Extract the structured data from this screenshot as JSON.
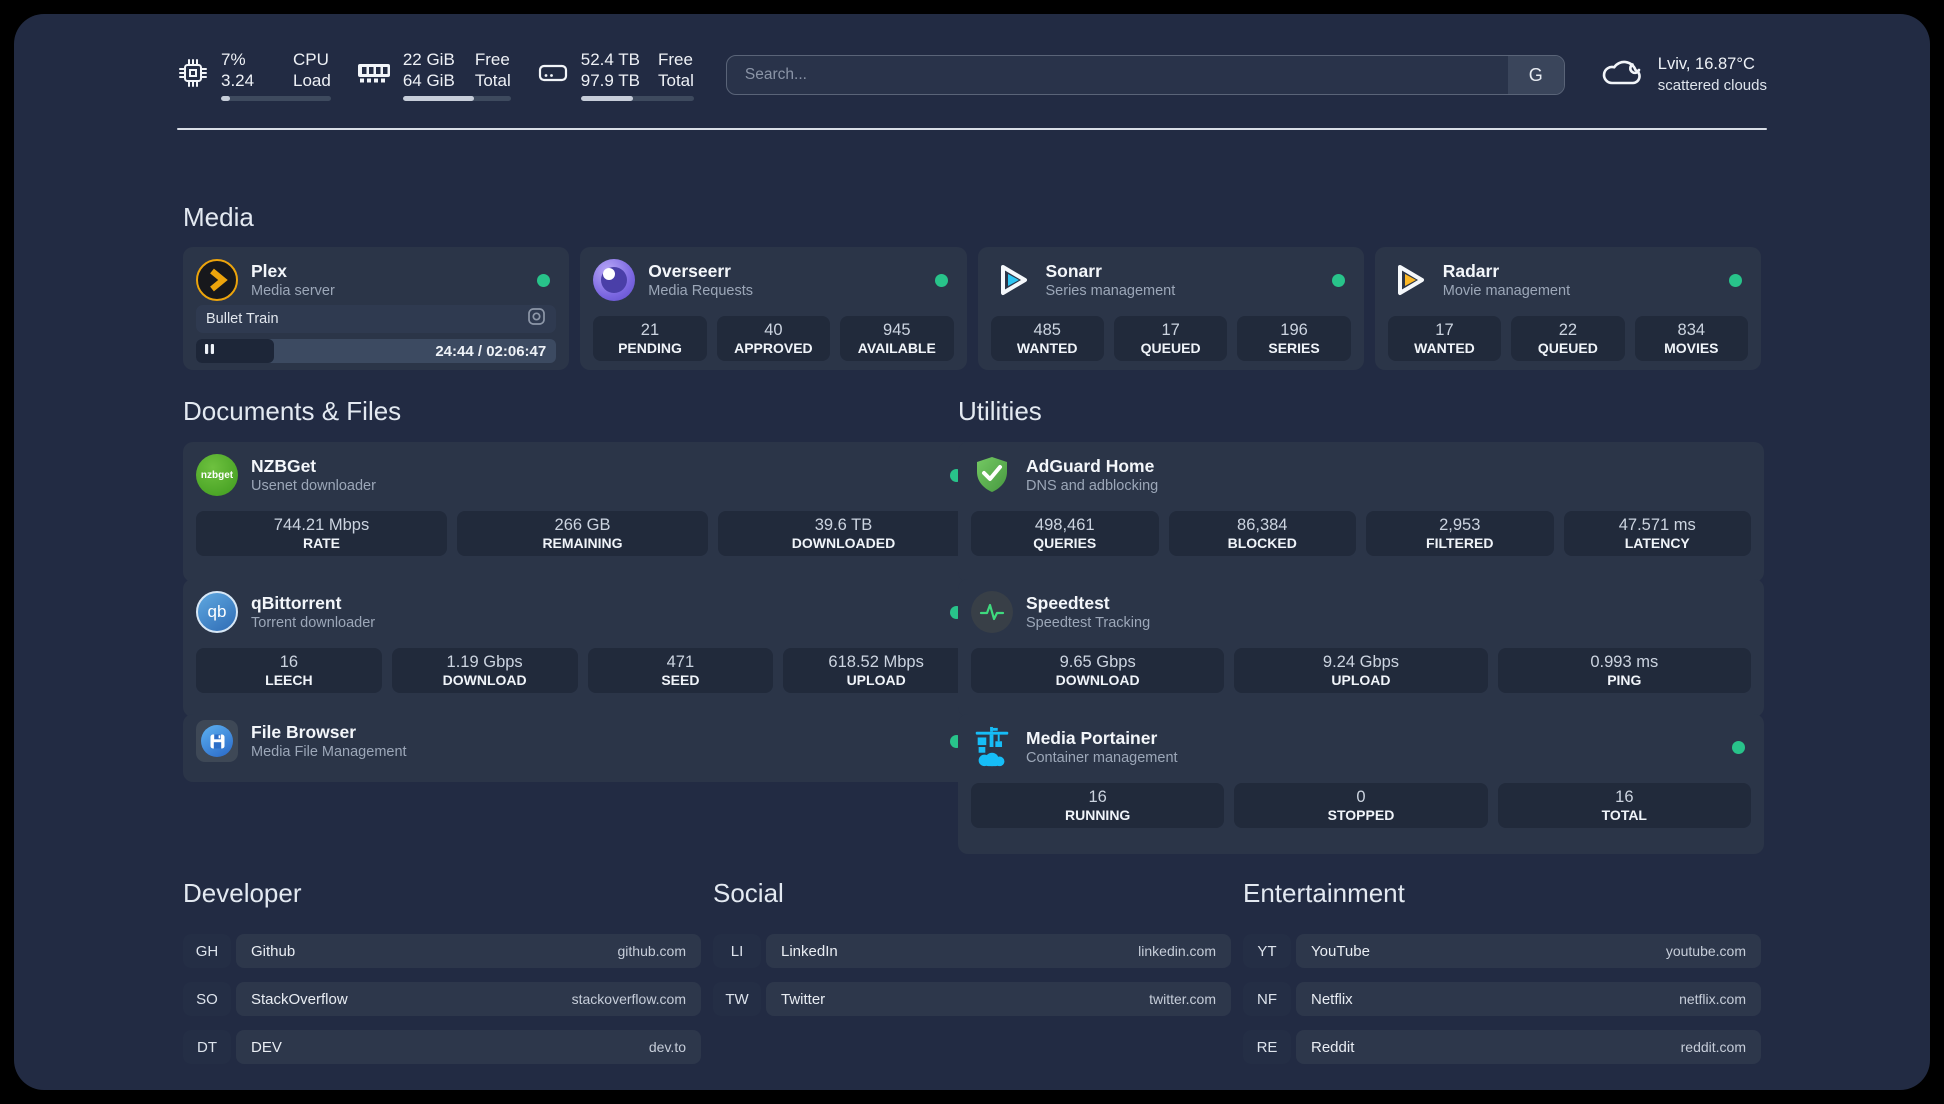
{
  "colors": {
    "status_online": "#28c38a",
    "panel_bg": "#222b43",
    "card_bg": "#2b3548",
    "plex_amber": "#eca40c",
    "sonarr_cyan": "#2ec5f1",
    "radarr_amber": "#fcb826",
    "adguard_green": "#5aaf4b",
    "portainer_blue": "#16bdf7",
    "speedtest_green": "#3eda7e"
  },
  "header": {
    "stats": [
      {
        "icon": "cpu-icon",
        "value_top": "7%",
        "value_bottom": "3.24",
        "label_top": "CPU",
        "label_bottom": "Load",
        "progress_pct": 8
      },
      {
        "icon": "memory-icon",
        "value_top": "22 GiB",
        "value_bottom": "64 GiB",
        "label_top": "Free",
        "label_bottom": "Total",
        "progress_pct": 66
      },
      {
        "icon": "disk-icon",
        "value_top": "52.4 TB",
        "value_bottom": "97.9 TB",
        "label_top": "Free",
        "label_bottom": "Total",
        "progress_pct": 46
      }
    ],
    "search": {
      "placeholder": "Search...",
      "button": "G"
    },
    "weather": {
      "icon": "cloud-icon",
      "line1": "Lviv, 16.87°C",
      "line2": "scattered clouds"
    }
  },
  "sections": {
    "media": {
      "title": "Media",
      "apps": [
        {
          "name": "Plex",
          "description": "Media server",
          "online": true,
          "now_playing": {
            "title": "Bullet Train",
            "time": "24:44 / 02:06:47",
            "progress_pct": 19.5
          }
        },
        {
          "name": "Overseerr",
          "description": "Media Requests",
          "online": true,
          "stats": [
            {
              "value": "21",
              "label": "PENDING"
            },
            {
              "value": "40",
              "label": "APPROVED"
            },
            {
              "value": "945",
              "label": "AVAILABLE"
            }
          ]
        },
        {
          "name": "Sonarr",
          "description": "Series management",
          "online": true,
          "stats": [
            {
              "value": "485",
              "label": "WANTED"
            },
            {
              "value": "17",
              "label": "QUEUED"
            },
            {
              "value": "196",
              "label": "SERIES"
            }
          ]
        },
        {
          "name": "Radarr",
          "description": "Movie management",
          "online": true,
          "stats": [
            {
              "value": "17",
              "label": "WANTED"
            },
            {
              "value": "22",
              "label": "QUEUED"
            },
            {
              "value": "834",
              "label": "MOVIES"
            }
          ]
        }
      ]
    },
    "documents": {
      "title": "Documents & Files",
      "apps": [
        {
          "name": "NZBGet",
          "description": "Usenet downloader",
          "icon_text": "nzbget",
          "online": true,
          "stats": [
            {
              "value": "744.21 Mbps",
              "label": "RATE"
            },
            {
              "value": "266 GB",
              "label": "REMAINING"
            },
            {
              "value": "39.6 TB",
              "label": "DOWNLOADED"
            }
          ]
        },
        {
          "name": "qBittorrent",
          "description": "Torrent downloader",
          "icon_text": "qb",
          "online": true,
          "stats": [
            {
              "value": "16",
              "label": "LEECH"
            },
            {
              "value": "1.19 Gbps",
              "label": "DOWNLOAD"
            },
            {
              "value": "471",
              "label": "SEED"
            },
            {
              "value": "618.52 Mbps",
              "label": "UPLOAD"
            }
          ]
        },
        {
          "name": "File Browser",
          "description": "Media File Management",
          "online": true
        }
      ]
    },
    "utilities": {
      "title": "Utilities",
      "apps": [
        {
          "name": "AdGuard Home",
          "description": "DNS and adblocking",
          "stats": [
            {
              "value": "498,461",
              "label": "QUERIES"
            },
            {
              "value": "86,384",
              "label": "BLOCKED"
            },
            {
              "value": "2,953",
              "label": "FILTERED"
            },
            {
              "value": "47.571 ms",
              "label": "LATENCY"
            }
          ]
        },
        {
          "name": "Speedtest",
          "description": "Speedtest Tracking",
          "stats": [
            {
              "value": "9.65 Gbps",
              "label": "DOWNLOAD"
            },
            {
              "value": "9.24 Gbps",
              "label": "UPLOAD"
            },
            {
              "value": "0.993 ms",
              "label": "PING"
            }
          ]
        },
        {
          "name": "Media Portainer",
          "description": "Container management",
          "online": true,
          "stats": [
            {
              "value": "16",
              "label": "RUNNING"
            },
            {
              "value": "0",
              "label": "STOPPED"
            },
            {
              "value": "16",
              "label": "TOTAL"
            }
          ]
        }
      ]
    },
    "bookmarks": [
      {
        "title": "Developer",
        "links": [
          {
            "abbr": "GH",
            "name": "Github",
            "url": "github.com"
          },
          {
            "abbr": "SO",
            "name": "StackOverflow",
            "url": "stackoverflow.com"
          },
          {
            "abbr": "DT",
            "name": "DEV",
            "url": "dev.to"
          }
        ]
      },
      {
        "title": "Social",
        "links": [
          {
            "abbr": "LI",
            "name": "LinkedIn",
            "url": "linkedin.com"
          },
          {
            "abbr": "TW",
            "name": "Twitter",
            "url": "twitter.com"
          }
        ]
      },
      {
        "title": "Entertainment",
        "links": [
          {
            "abbr": "YT",
            "name": "YouTube",
            "url": "youtube.com"
          },
          {
            "abbr": "NF",
            "name": "Netflix",
            "url": "netflix.com"
          },
          {
            "abbr": "RE",
            "name": "Reddit",
            "url": "reddit.com"
          }
        ]
      }
    ]
  }
}
